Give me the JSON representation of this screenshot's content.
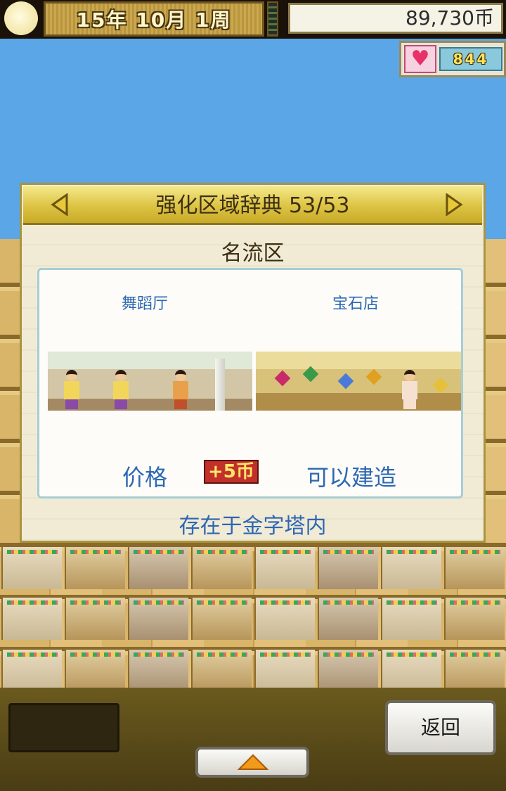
{
  "hud": {
    "date": "15年 10月 1周",
    "money": "89,730币",
    "hearts": "844"
  },
  "dialog": {
    "title": "强化区域辞典 53/53",
    "zone_name": "名流区",
    "facilities": [
      {
        "name": "舞蹈厅"
      },
      {
        "name": "宝石店"
      }
    ],
    "price_label": "价格",
    "price_badge": "+5币",
    "status": "可以建造",
    "location": "存在于金字塔内"
  },
  "buttons": {
    "back": "返回"
  },
  "icons": {
    "prev": "arrow-left-icon",
    "next": "arrow-right-icon",
    "heart": "heart-icon",
    "up": "arrow-up-icon",
    "sun": "sun-icon"
  },
  "colors": {
    "accent_blue": "#2c67b4",
    "header_gold": "#dcc342",
    "sky": "#5aa6e6"
  }
}
